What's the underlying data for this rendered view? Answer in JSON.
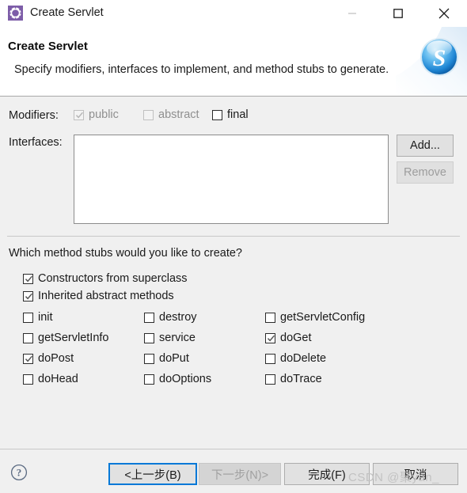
{
  "window": {
    "title": "Create Servlet",
    "icon": "servlet-gear-icon",
    "controls": {
      "minimize": "minimize-icon",
      "maximize": "maximize-icon",
      "close": "close-icon"
    }
  },
  "header": {
    "title": "Create Servlet",
    "description": "Specify modifiers, interfaces to implement, and method stubs to generate.",
    "logo": "servlet-blue-s-sphere-icon"
  },
  "modifiers": {
    "label": "Modifiers:",
    "items": [
      {
        "label": "public",
        "checked": true,
        "enabled": false
      },
      {
        "label": "abstract",
        "checked": false,
        "enabled": false
      },
      {
        "label": "final",
        "checked": false,
        "enabled": true
      }
    ]
  },
  "interfaces": {
    "label": "Interfaces:",
    "entries": [],
    "add_label": "Add...",
    "remove_label": "Remove",
    "add_enabled": true,
    "remove_enabled": false
  },
  "stubs": {
    "question": "Which method stubs would you like to create?",
    "top_options": [
      {
        "label": "Constructors from superclass",
        "checked": true
      },
      {
        "label": "Inherited abstract methods",
        "checked": true
      }
    ],
    "grid": {
      "col1": [
        {
          "label": "init",
          "checked": false
        },
        {
          "label": "getServletInfo",
          "checked": false
        },
        {
          "label": "doPost",
          "checked": true
        },
        {
          "label": "doHead",
          "checked": false
        }
      ],
      "col2": [
        {
          "label": "destroy",
          "checked": false
        },
        {
          "label": "service",
          "checked": false
        },
        {
          "label": "doPut",
          "checked": false
        },
        {
          "label": "doOptions",
          "checked": false
        }
      ],
      "col3": [
        {
          "label": "getServletConfig",
          "checked": false
        },
        {
          "label": "doGet",
          "checked": true
        },
        {
          "label": "doDelete",
          "checked": false
        },
        {
          "label": "doTrace",
          "checked": false
        }
      ]
    }
  },
  "footer": {
    "help": "help-question-icon",
    "buttons": [
      {
        "label": "<上一步(B)",
        "enabled": true,
        "focused": true
      },
      {
        "label": "下一步(N)>",
        "enabled": false,
        "focused": false
      },
      {
        "label": "完成(F)",
        "enabled": true,
        "focused": false
      },
      {
        "label": "取消",
        "enabled": true,
        "focused": false
      }
    ]
  },
  "watermark": "CSDN @聚yan_",
  "colors": {
    "dialog_bg": "#f0f0f0",
    "header_bg": "#ffffff",
    "accent_focus": "#0078d7",
    "icon_purple": "#7d5da8",
    "logo_blue": "#2ea3e8",
    "text": "#1a1a1a",
    "disabled_text": "#9a9a9a"
  }
}
